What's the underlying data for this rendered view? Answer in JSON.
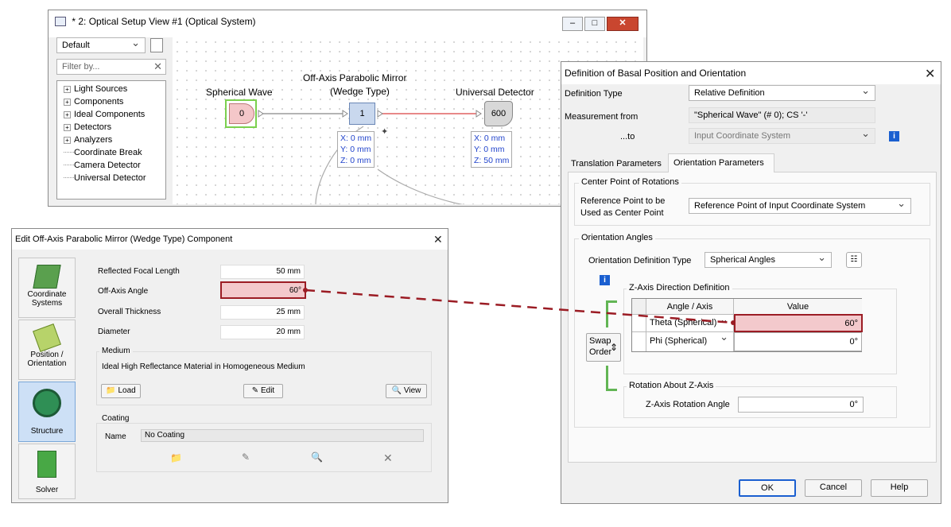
{
  "setup_window": {
    "title": "* 2: Optical Setup View #1 (Optical System)",
    "view_select": "Default",
    "filter_placeholder": "Filter by...",
    "tree": [
      "Light Sources",
      "Components",
      "Ideal Components",
      "Detectors",
      "Analyzers",
      "Coordinate Break",
      "Camera Detector",
      "Universal Detector"
    ],
    "tree_expandable": [
      true,
      true,
      true,
      true,
      true,
      false,
      false,
      false
    ],
    "nodes": {
      "source": {
        "label": "Spherical Wave",
        "id": "0"
      },
      "mirror": {
        "label_line1": "Off-Axis Parabolic Mirror",
        "label_line2": "(Wedge Type)",
        "id": "1"
      },
      "detector": {
        "label": "Universal Detector",
        "id": "600"
      }
    },
    "mirror_coords": [
      "X: 0 mm",
      "Y: 0 mm",
      "Z: 0 mm"
    ],
    "detector_coords": [
      "X: 0 mm",
      "Y: 0 mm",
      "Z: 50 mm"
    ]
  },
  "edit_dialog": {
    "title": "Edit Off-Axis Parabolic Mirror (Wedge Type) Component",
    "sidebar": [
      {
        "label1": "Coordinate",
        "label2": "Systems",
        "icon": "coordinate-systems-icon"
      },
      {
        "label1": "Position /",
        "label2": "Orientation",
        "icon": "position-orientation-icon"
      },
      {
        "label1": "Structure",
        "label2": "",
        "icon": "structure-icon"
      },
      {
        "label1": "Solver",
        "label2": "",
        "icon": "solver-icon"
      }
    ],
    "params": [
      {
        "label": "Reflected Focal Length",
        "value": "50 mm"
      },
      {
        "label": "Off-Axis Angle",
        "value": "60°"
      },
      {
        "label": "Overall Thickness",
        "value": "25 mm"
      },
      {
        "label": "Diameter",
        "value": "20 mm"
      }
    ],
    "medium": {
      "title": "Medium",
      "text": "Ideal High Reflectance Material in Homogeneous Medium",
      "load": "Load",
      "edit": "Edit",
      "view": "View"
    },
    "coating": {
      "title": "Coating",
      "name_label": "Name",
      "name_value": "No Coating"
    }
  },
  "basal_dialog": {
    "title": "Definition of Basal Position and Orientation",
    "definition_type_label": "Definition Type",
    "definition_type_value": "Relative Definition",
    "measurement_from_label": "Measurement from",
    "measurement_from_value": "\"Spherical Wave\" (# 0); CS '-'",
    "to_label": "...to",
    "to_value": "Input Coordinate System",
    "tabs": [
      "Translation Parameters",
      "Orientation Parameters"
    ],
    "center_group": "Center Point of Rotations",
    "ref_point_label1": "Reference Point to be",
    "ref_point_label2": "Used as Center Point",
    "ref_point_value": "Reference Point of Input Coordinate System",
    "angles_group": "Orientation Angles",
    "orient_def_label": "Orientation Definition Type",
    "orient_def_value": "Spherical Angles",
    "z_axis_group": "Z-Axis Direction Definition",
    "table_headers": [
      "Angle / Axis",
      "Value"
    ],
    "table_rows": [
      {
        "angle": "Theta (Spherical)",
        "value": "60°"
      },
      {
        "angle": "Phi (Spherical)",
        "value": "0°"
      }
    ],
    "swap_label1": "Swap",
    "swap_label2": "Order",
    "rotation_group": "Rotation About Z-Axis",
    "z_rot_label": "Z-Axis Rotation Angle",
    "z_rot_value": "0°",
    "ok": "OK",
    "cancel": "Cancel",
    "help": "Help"
  },
  "colors": {
    "highlight_border": "#9b1c24",
    "highlight_fill": "#f3c9cc",
    "beam": "#e06060",
    "info_blue": "#1a5fd0"
  }
}
